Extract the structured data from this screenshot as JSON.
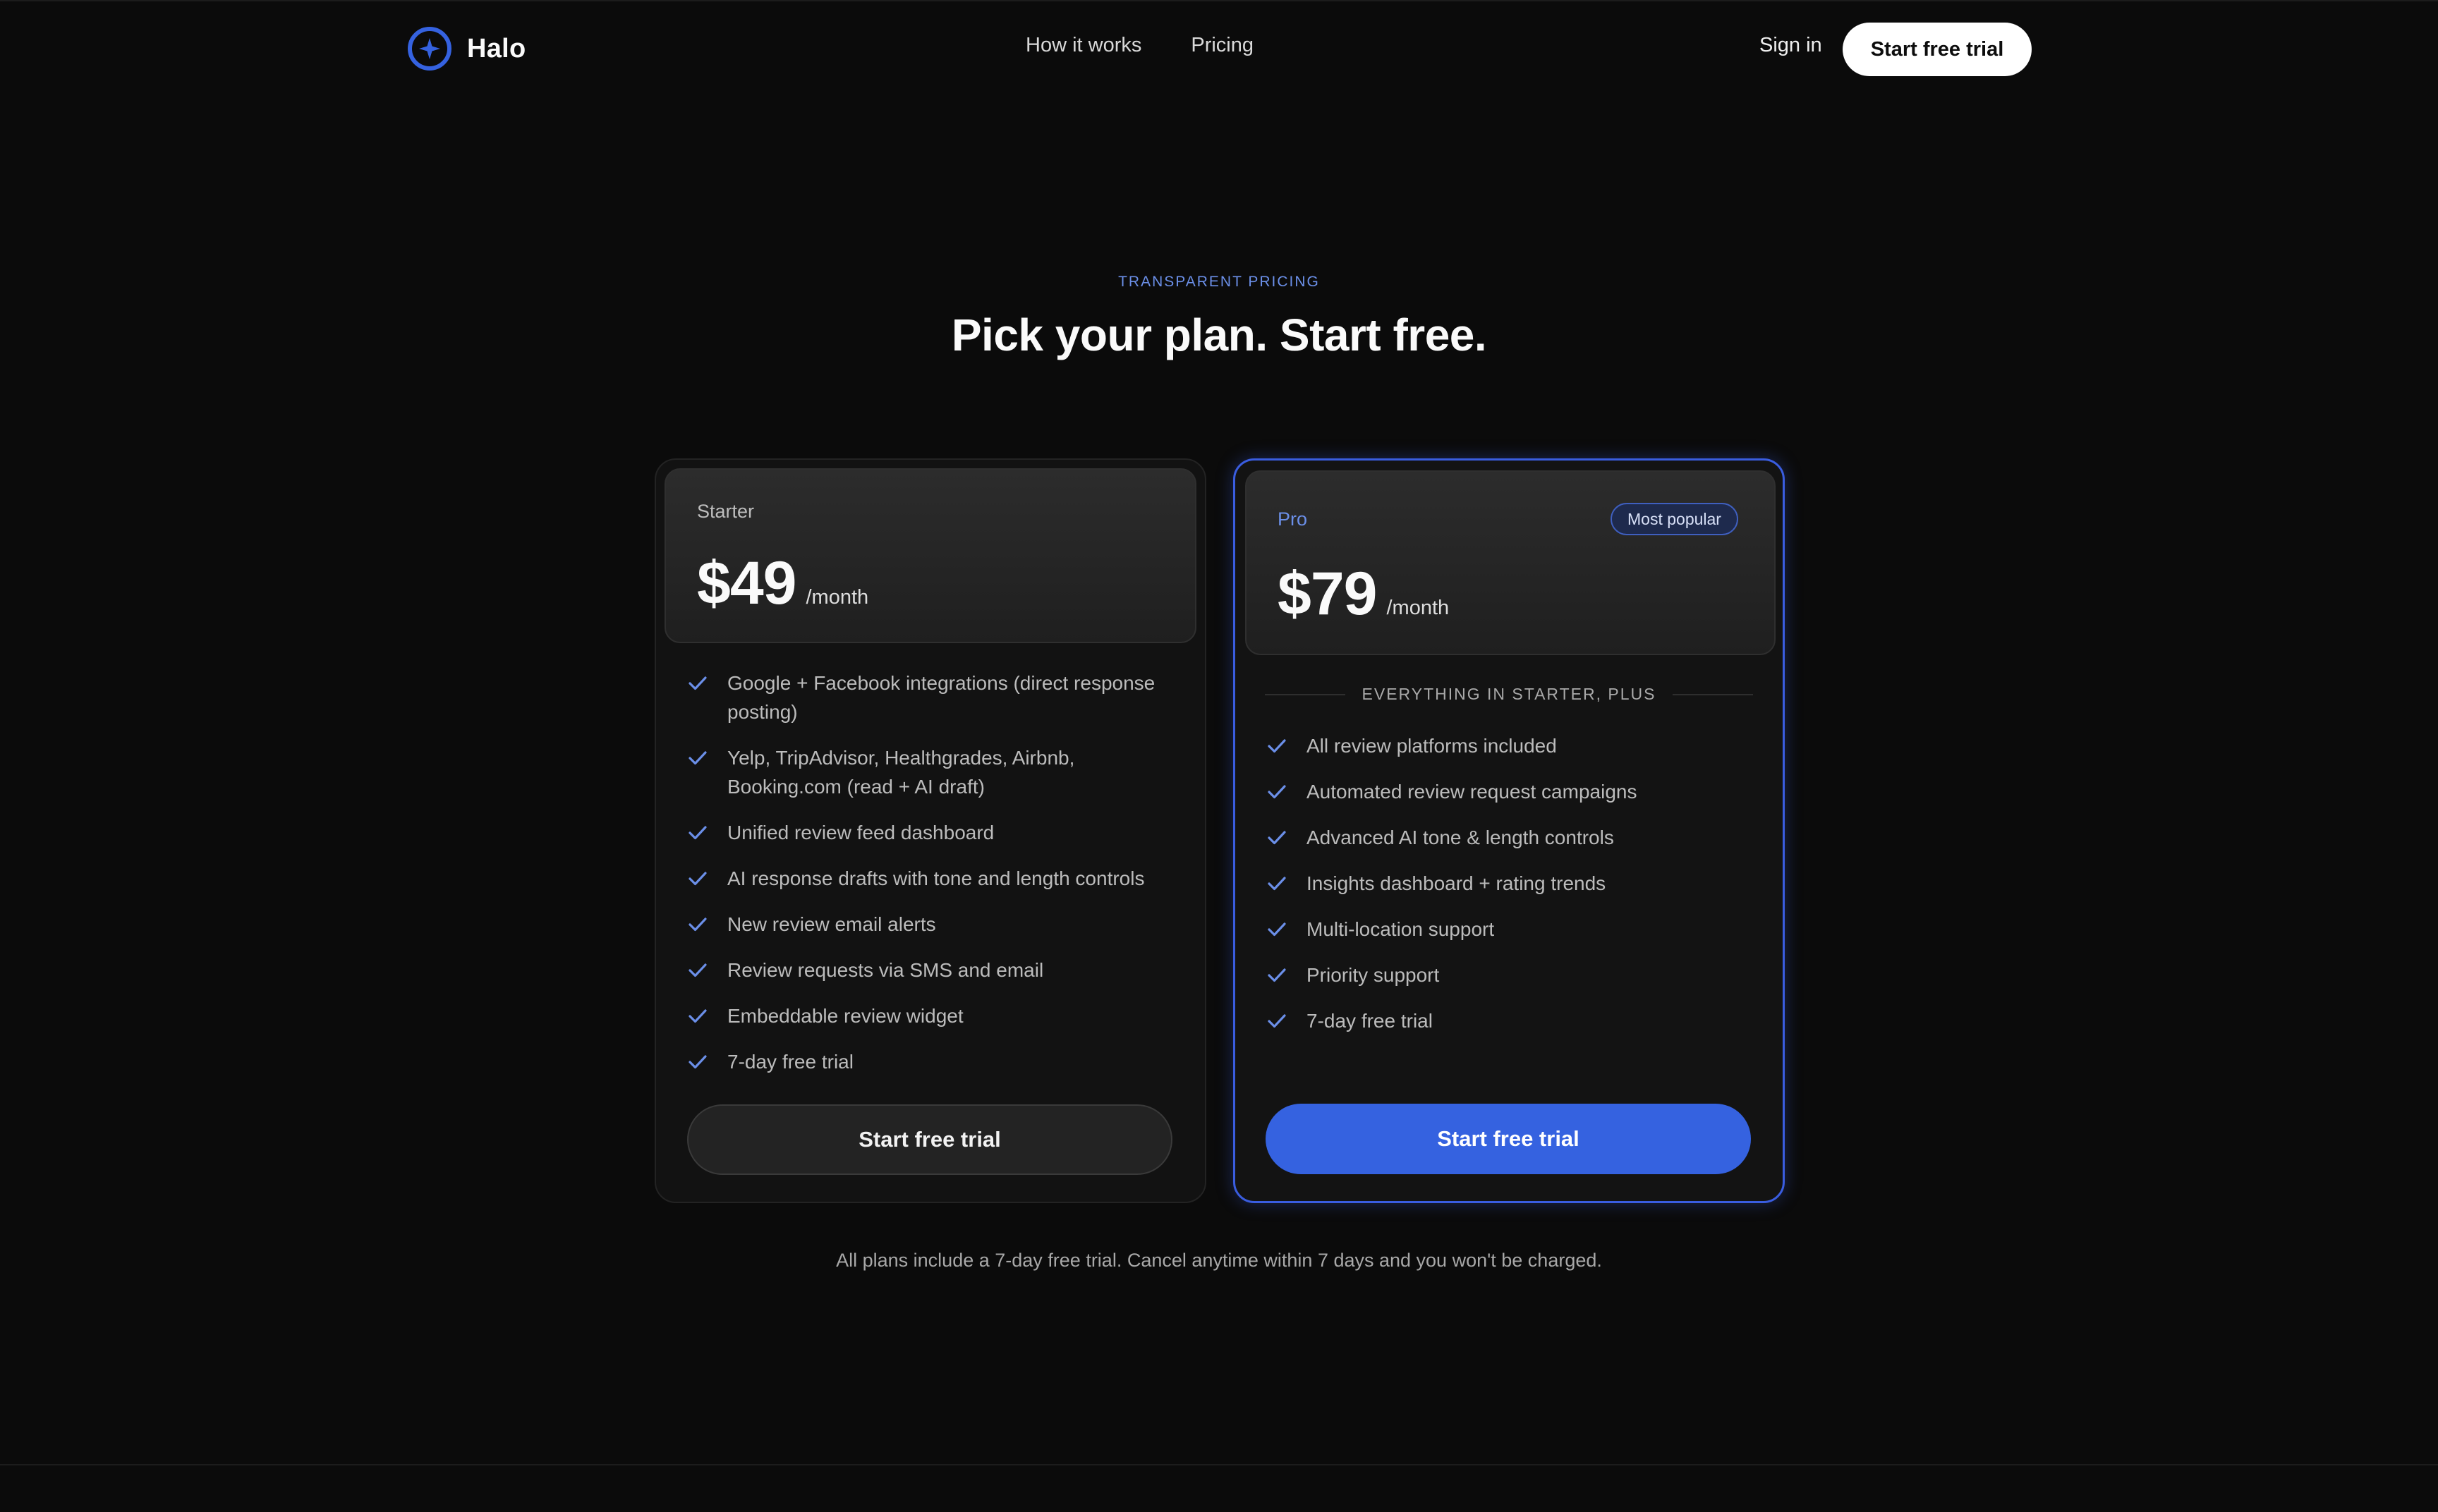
{
  "brand": {
    "name": "Halo",
    "accent": "#3562e0",
    "logo_icon": "halo-compass-icon"
  },
  "nav": {
    "links": [
      "How it works",
      "Pricing"
    ],
    "sign_in": "Sign in",
    "cta": "Start free trial"
  },
  "hero": {
    "eyebrow": "TRANSPARENT PRICING",
    "headline": "Pick your plan. Start free."
  },
  "plans": [
    {
      "name": "Starter",
      "price": "$49",
      "period": "/month",
      "features": [
        "Google + Facebook integrations (direct response posting)",
        "Yelp, TripAdvisor, Healthgrades, Airbnb, Booking.com (read + AI draft)",
        "Unified review feed dashboard",
        "AI response drafts with tone and length controls",
        "New review email alerts",
        "Review requests via SMS and email",
        "Embeddable review widget",
        "7-day free trial"
      ],
      "cta": "Start free trial"
    },
    {
      "name": "Pro",
      "badge": "Most popular",
      "price": "$79",
      "period": "/month",
      "divider": "EVERYTHING IN STARTER, PLUS",
      "features": [
        "All review platforms included",
        "Automated review request campaigns",
        "Advanced AI tone & length controls",
        "Insights dashboard + rating trends",
        "Multi-location support",
        "Priority support",
        "7-day free trial"
      ],
      "cta": "Start free trial"
    }
  ],
  "footnote": "All plans include a 7-day free trial. Cancel anytime within 7 days and you won't be charged."
}
